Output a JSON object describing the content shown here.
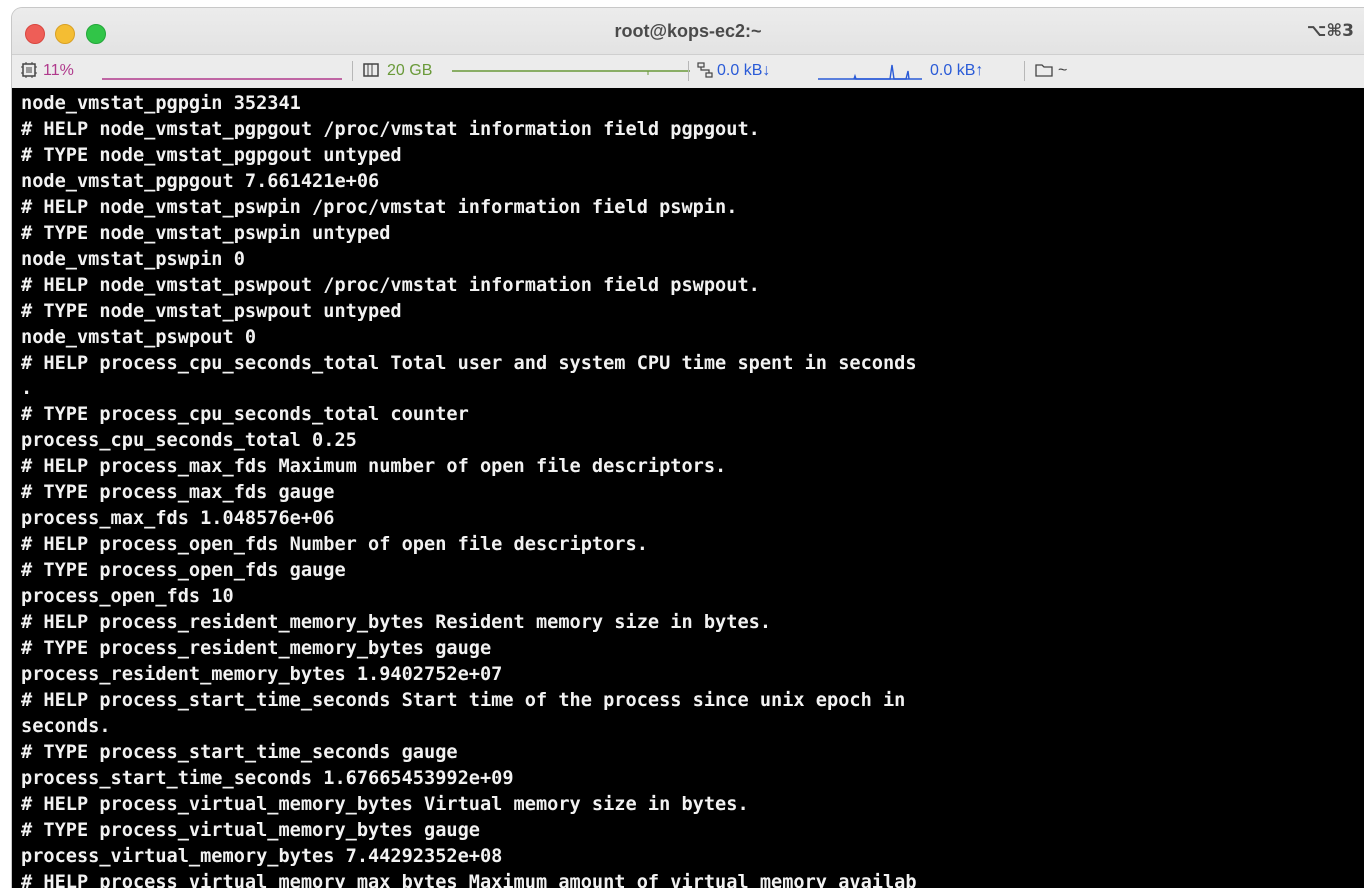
{
  "window": {
    "title": "root@kops-ec2:~",
    "shortcut": "⌥⌘3"
  },
  "status_bar": {
    "cpu_percent": "11%",
    "memory": "20 GB",
    "download": "0.0 kB↓",
    "upload": "0.0 kB↑",
    "directory": "~",
    "colors": {
      "cpu": "#b03a8c",
      "memory": "#6a9a3a",
      "network": "#2a5bd7"
    }
  },
  "terminal": {
    "lines": [
      "node_vmstat_pgpgin 352341",
      "# HELP node_vmstat_pgpgout /proc/vmstat information field pgpgout.",
      "# TYPE node_vmstat_pgpgout untyped",
      "node_vmstat_pgpgout 7.661421e+06",
      "# HELP node_vmstat_pswpin /proc/vmstat information field pswpin.",
      "# TYPE node_vmstat_pswpin untyped",
      "node_vmstat_pswpin 0",
      "# HELP node_vmstat_pswpout /proc/vmstat information field pswpout.",
      "# TYPE node_vmstat_pswpout untyped",
      "node_vmstat_pswpout 0",
      "# HELP process_cpu_seconds_total Total user and system CPU time spent in seconds",
      ".",
      "# TYPE process_cpu_seconds_total counter",
      "process_cpu_seconds_total 0.25",
      "# HELP process_max_fds Maximum number of open file descriptors.",
      "# TYPE process_max_fds gauge",
      "process_max_fds 1.048576e+06",
      "# HELP process_open_fds Number of open file descriptors.",
      "# TYPE process_open_fds gauge",
      "process_open_fds 10",
      "# HELP process_resident_memory_bytes Resident memory size in bytes.",
      "# TYPE process_resident_memory_bytes gauge",
      "process_resident_memory_bytes 1.9402752e+07",
      "# HELP process_start_time_seconds Start time of the process since unix epoch in",
      "seconds.",
      "# TYPE process_start_time_seconds gauge",
      "process_start_time_seconds 1.67665453992e+09",
      "# HELP process_virtual_memory_bytes Virtual memory size in bytes.",
      "# TYPE process_virtual_memory_bytes gauge",
      "process_virtual_memory_bytes 7.44292352e+08",
      "# HELP process_virtual_memory_max_bytes Maximum amount of virtual memory availab"
    ]
  }
}
